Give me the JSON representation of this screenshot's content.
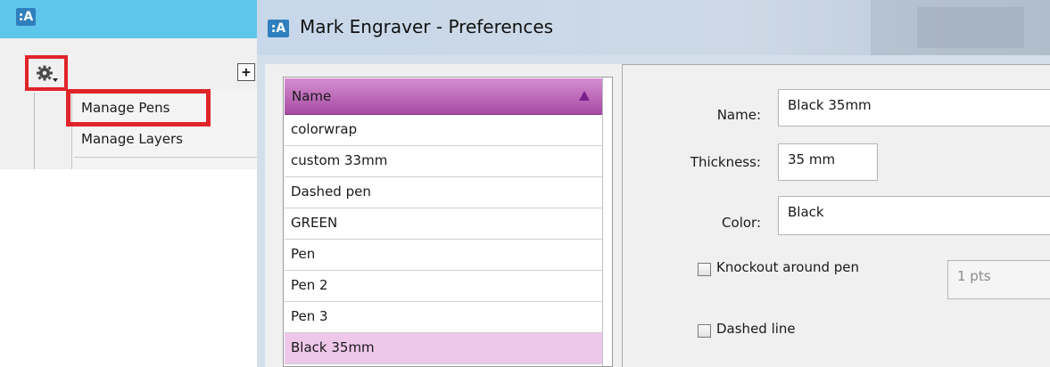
{
  "small_window": {
    "logo": ":A",
    "add_button_label": "+",
    "menu": {
      "items": [
        {
          "label": "Manage Pens"
        },
        {
          "label": "Manage Layers"
        }
      ]
    }
  },
  "preferences": {
    "logo": ":A",
    "title": "Mark Engraver - Preferences",
    "list": {
      "header": "Name",
      "rows": [
        "colorwrap",
        "custom 33mm",
        "Dashed pen",
        "GREEN",
        "Pen",
        "Pen 2",
        "Pen 3",
        "Black 35mm"
      ],
      "selected": "Black 35mm"
    },
    "form": {
      "name_label": "Name:",
      "name_value": "Black 35mm",
      "thickness_label": "Thickness:",
      "thickness_value": "35 mm",
      "color_label": "Color:",
      "color_value": "Black",
      "knockout_label": "Knockout around pen",
      "knockout_checked": false,
      "knockout_value": "1 pts",
      "dashed_label": "Dashed line",
      "dashed_checked": false
    }
  },
  "colors": {
    "highlight_red": "#e0242a",
    "header_purple": "#a64aa2",
    "selected_row": "#eec7ea",
    "titlebar_blue": "#5ec6ea"
  },
  "icons": [
    "gear-dropdown-icon",
    "sort-ascending-icon",
    "app-logo-icon"
  ]
}
